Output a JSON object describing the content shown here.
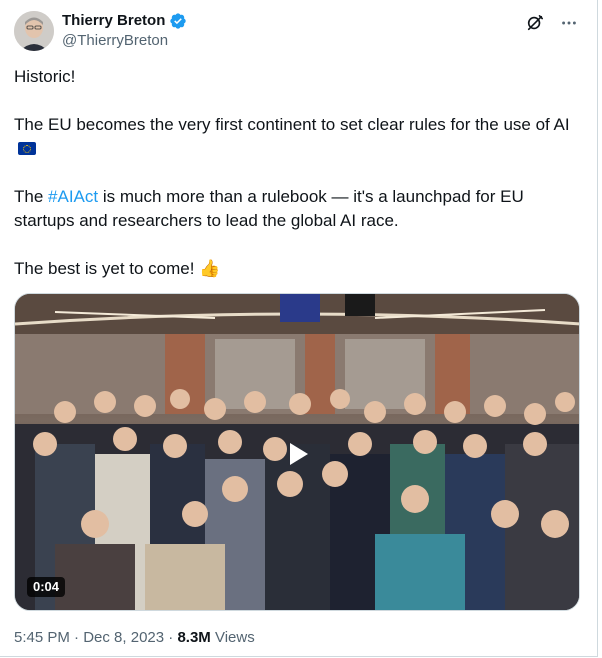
{
  "author": {
    "name": "Thierry Breton",
    "handle": "@ThierryBreton",
    "verified": true
  },
  "icons": {
    "avatar": "avatar",
    "verified": "verified-badge-icon",
    "grok": "grok-icon",
    "more": "more-options-icon",
    "play": "play-icon"
  },
  "tweet": {
    "line1": "Historic!",
    "line2": "The EU becomes the very first continent to set clear rules for the use of AI",
    "line3_prefix": "The ",
    "line3_hashtag": "#AIAct",
    "line3_suffix": " is much more than a rulebook — it's a launchpad for EU startups and researchers to lead the global AI race.",
    "line4": "The best is yet to come!"
  },
  "media": {
    "duration": "0:04"
  },
  "meta": {
    "time": "5:45 PM",
    "sep1": " · ",
    "date": "Dec 8, 2023",
    "sep2": " · ",
    "views_count": "8.3M",
    "views_label": " Views"
  },
  "colors": {
    "link": "#1d9bf0",
    "text": "#0f1419",
    "secondary": "#536471"
  }
}
